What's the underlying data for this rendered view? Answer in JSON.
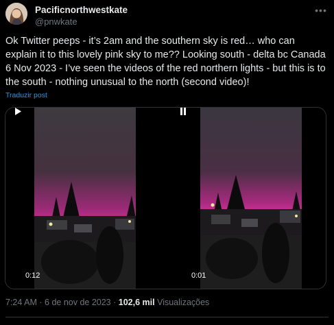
{
  "author": {
    "display_name": "Pacificnorthwestkate",
    "handle": "@pnwkate"
  },
  "tweet": {
    "text": "Ok Twitter peeps - it’s 2am and the southern sky is red… who can explain it to this lovely pink sky to me?? Looking south - delta bc Canada 6 Nov 2023 - I’ve seen the videos of the red northern lights - but this is to the south - nothing unusual to the north (second video)!",
    "translate_label": "Traduzir post"
  },
  "media": {
    "videos": [
      {
        "state": "paused",
        "control_icon": "play-icon",
        "time": "0:12"
      },
      {
        "state": "playing",
        "control_icon": "pause-icon",
        "time": "0:01"
      }
    ]
  },
  "meta": {
    "time": "7:24 AM",
    "separator": "·",
    "date": "6 de nov de 2023",
    "views_count": "102,6 mil",
    "views_label": "Visualizações"
  },
  "icons": {
    "more": "more-options-icon"
  },
  "colors": {
    "background": "#000000",
    "text": "#e7e9ea",
    "secondary": "#71767b",
    "link": "#1d9bf0",
    "sky_pink": "#c22a8a"
  }
}
